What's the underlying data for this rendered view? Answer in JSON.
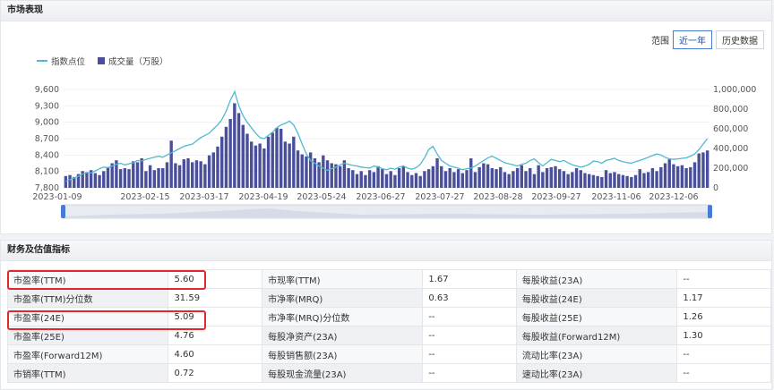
{
  "market": {
    "title": "市场表现",
    "range_label": "范围",
    "range_buttons": [
      "近一年",
      "历史数据"
    ],
    "legend": {
      "line": "指数点位",
      "bar": "成交量（万股）"
    },
    "colors": {
      "line": "#4fb9cf",
      "bar": "#4a4f9c"
    }
  },
  "chart_data": {
    "type": "bar",
    "x_ticks": [
      "2023-01-09",
      "2023-02-15",
      "2023-03-17",
      "2023-04-19",
      "2023-05-24",
      "2023-06-27",
      "2023-07-27",
      "2023-08-28",
      "2023-09-27",
      "2023-11-06",
      "2023-12-06"
    ],
    "x_range": [
      "2023-01-03",
      "2023-12-29"
    ],
    "y_left": {
      "ticks": [
        "9,600",
        "9,300",
        "9,000",
        "8,700",
        "8,400",
        "8,100",
        "7,800"
      ],
      "range": [
        7800,
        9600
      ]
    },
    "y_right": {
      "ticks": [
        "1,000,000",
        "800,000",
        "600,000",
        "400,000",
        "200,000",
        "0"
      ],
      "range": [
        0,
        1000000
      ]
    },
    "series": [
      {
        "name": "指数点位",
        "kind": "line",
        "values": [
          7920,
          7950,
          7980,
          8010,
          8050,
          8080,
          8070,
          8110,
          8150,
          8180,
          8170,
          8200,
          8230,
          8250,
          8220,
          8240,
          8260,
          8300,
          8290,
          8320,
          8340,
          8360,
          8380,
          8360,
          8400,
          8440,
          8480,
          8520,
          8560,
          8580,
          8600,
          8660,
          8720,
          8760,
          8800,
          8880,
          8950,
          9050,
          9200,
          9400,
          9560,
          9300,
          9120,
          9000,
          8900,
          8800,
          8720,
          8700,
          8760,
          8820,
          8900,
          8950,
          8980,
          9020,
          8950,
          8800,
          8600,
          8420,
          8300,
          8250,
          8200,
          8160,
          8120,
          8150,
          8180,
          8220,
          8250,
          8230,
          8210,
          8200,
          8180,
          8170,
          8160,
          8200,
          8180,
          8150,
          8130,
          8160,
          8140,
          8180,
          8200,
          8160,
          8140,
          8170,
          8230,
          8350,
          8500,
          8560,
          8420,
          8300,
          8250,
          8200,
          8180,
          8160,
          8130,
          8150,
          8160,
          8200,
          8250,
          8300,
          8350,
          8380,
          8340,
          8300,
          8260,
          8240,
          8220,
          8200,
          8230,
          8250,
          8300,
          8330,
          8260,
          8200,
          8260,
          8320,
          8300,
          8280,
          8300,
          8260,
          8220,
          8200,
          8180,
          8200,
          8230,
          8290,
          8280,
          8250,
          8300,
          8320,
          8340,
          8300,
          8280,
          8260,
          8250,
          8280,
          8300,
          8330,
          8360,
          8390,
          8420,
          8400,
          8360,
          8330,
          8320,
          8330,
          8340,
          8350,
          8380,
          8420,
          8500,
          8600,
          8700
        ]
      },
      {
        "name": "成交量（万股）",
        "kind": "bar",
        "values": [
          120000,
          130000,
          110000,
          140000,
          170000,
          160000,
          180000,
          150000,
          130000,
          170000,
          210000,
          250000,
          280000,
          190000,
          200000,
          190000,
          270000,
          260000,
          300000,
          170000,
          230000,
          180000,
          200000,
          200000,
          260000,
          480000,
          250000,
          230000,
          290000,
          300000,
          260000,
          280000,
          270000,
          240000,
          330000,
          360000,
          420000,
          520000,
          620000,
          700000,
          860000,
          760000,
          640000,
          550000,
          470000,
          430000,
          450000,
          400000,
          520000,
          560000,
          610000,
          600000,
          470000,
          450000,
          520000,
          380000,
          340000,
          320000,
          360000,
          300000,
          260000,
          330000,
          280000,
          250000,
          240000,
          220000,
          280000,
          200000,
          180000,
          140000,
          170000,
          130000,
          180000,
          160000,
          220000,
          190000,
          140000,
          170000,
          130000,
          200000,
          220000,
          160000,
          130000,
          150000,
          120000,
          170000,
          190000,
          220000,
          300000,
          220000,
          170000,
          200000,
          160000,
          190000,
          150000,
          180000,
          300000,
          160000,
          210000,
          250000,
          240000,
          200000,
          190000,
          210000,
          160000,
          140000,
          170000,
          200000,
          230000,
          170000,
          200000,
          140000,
          230000,
          160000,
          200000,
          210000,
          220000,
          190000,
          170000,
          140000,
          160000,
          200000,
          180000,
          150000,
          140000,
          130000,
          120000,
          110000,
          180000,
          150000,
          160000,
          140000,
          130000,
          120000,
          110000,
          130000,
          190000,
          150000,
          160000,
          200000,
          170000,
          210000,
          250000,
          290000,
          240000,
          220000,
          230000,
          200000,
          210000,
          260000,
          350000,
          360000,
          380000
        ]
      }
    ]
  },
  "financials": {
    "title": "财务及估值指标",
    "rows": [
      [
        "市盈率(TTM)",
        "5.60",
        "市现率(TTM)",
        "1.67",
        "每股收益(23A)",
        "--"
      ],
      [
        "市盈率(TTM)分位数",
        "31.59",
        "市净率(MRQ)",
        "0.63",
        "每股收益(24E)",
        "1.17"
      ],
      [
        "市盈率(24E)",
        "5.09",
        "市净率(MRQ)分位数",
        "--",
        "每股收益(25E)",
        "1.26"
      ],
      [
        "市盈率(25E)",
        "4.76",
        "每股净资产(23A)",
        "--",
        "每股收益(Forward12M)",
        "1.30"
      ],
      [
        "市盈率(Forward12M)",
        "4.60",
        "每股销售额(23A)",
        "--",
        "流动比率(23A)",
        "--"
      ],
      [
        "市销率(TTM)",
        "0.72",
        "每股现金流量(23A)",
        "--",
        "速动比率(23A)",
        "--"
      ]
    ],
    "highlight_color": "#e0282d"
  }
}
